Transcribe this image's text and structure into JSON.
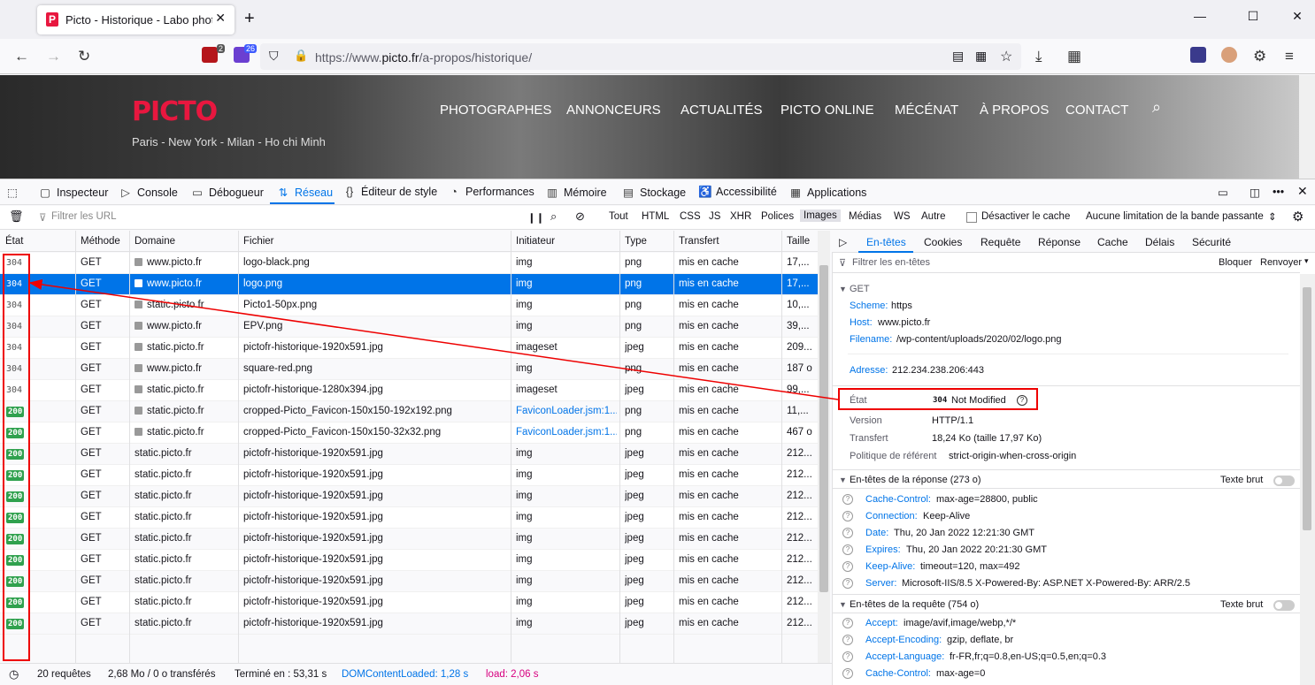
{
  "browser": {
    "tab_title": "Picto - Historique - Labo photo",
    "tab_favicon": "P",
    "url_scheme": "https://www.",
    "url_host": "picto.fr",
    "url_path": "/a-propos/historique/",
    "ext_badge_1": "2",
    "ext_badge_2": "26"
  },
  "site": {
    "logo": "PICTO",
    "tagline": "Paris - New York - Milan - Ho chi Minh",
    "menu": [
      "PHOTOGRAPHES",
      "ANNONCEURS",
      "ACTUALITÉS",
      "PICTO ONLINE",
      "MÉCÉNAT",
      "À PROPOS",
      "CONTACT"
    ]
  },
  "devtools": {
    "tools": [
      "Inspecteur",
      "Console",
      "Débogueur",
      "Réseau",
      "Éditeur de style",
      "Performances",
      "Mémoire",
      "Stockage",
      "Accessibilité",
      "Applications"
    ],
    "filter_placeholder": "Filtrer les URL",
    "types": [
      "Tout",
      "HTML",
      "CSS",
      "JS",
      "XHR",
      "Polices",
      "Images",
      "Médias",
      "WS",
      "Autre"
    ],
    "disable_cache": "Désactiver le cache",
    "throttle": "Aucune limitation de la bande passante",
    "columns": [
      "État",
      "Méthode",
      "Domaine",
      "Fichier",
      "Initiateur",
      "Type",
      "Transfert",
      "Taille"
    ],
    "rows": [
      {
        "status": "304",
        "method": "GET",
        "domain": "www.picto.fr",
        "file": "logo-black.png",
        "initiator": "img",
        "type": "png",
        "transfer": "mis en cache",
        "size": "17,..."
      },
      {
        "status": "304",
        "method": "GET",
        "domain": "www.picto.fr",
        "file": "logo.png",
        "initiator": "img",
        "type": "png",
        "transfer": "mis en cache",
        "size": "17,..."
      },
      {
        "status": "304",
        "method": "GET",
        "domain": "static.picto.fr",
        "file": "Picto1-50px.png",
        "initiator": "img",
        "type": "png",
        "transfer": "mis en cache",
        "size": "10,..."
      },
      {
        "status": "304",
        "method": "GET",
        "domain": "www.picto.fr",
        "file": "EPV.png",
        "initiator": "img",
        "type": "png",
        "transfer": "mis en cache",
        "size": "39,..."
      },
      {
        "status": "304",
        "method": "GET",
        "domain": "static.picto.fr",
        "file": "pictofr-historique-1920x591.jpg",
        "initiator": "imageset",
        "type": "jpeg",
        "transfer": "mis en cache",
        "size": "209..."
      },
      {
        "status": "304",
        "method": "GET",
        "domain": "www.picto.fr",
        "file": "square-red.png",
        "initiator": "img",
        "type": "png",
        "transfer": "mis en cache",
        "size": "187 o"
      },
      {
        "status": "304",
        "method": "GET",
        "domain": "static.picto.fr",
        "file": "pictofr-historique-1280x394.jpg",
        "initiator": "imageset",
        "type": "jpeg",
        "transfer": "mis en cache",
        "size": "99,..."
      },
      {
        "status": "200",
        "method": "GET",
        "domain": "static.picto.fr",
        "file": "cropped-Picto_Favicon-150x150-192x192.png",
        "initiator": "FaviconLoader.jsm:1...",
        "type": "png",
        "transfer": "mis en cache",
        "size": "11,..."
      },
      {
        "status": "200",
        "method": "GET",
        "domain": "static.picto.fr",
        "file": "cropped-Picto_Favicon-150x150-32x32.png",
        "initiator": "FaviconLoader.jsm:1...",
        "type": "png",
        "transfer": "mis en cache",
        "size": "467 o"
      },
      {
        "status": "200",
        "method": "GET",
        "domain": "static.picto.fr",
        "file": "pictofr-historique-1920x591.jpg",
        "initiator": "img",
        "type": "jpeg",
        "transfer": "mis en cache",
        "size": "212..."
      },
      {
        "status": "200",
        "method": "GET",
        "domain": "static.picto.fr",
        "file": "pictofr-historique-1920x591.jpg",
        "initiator": "img",
        "type": "jpeg",
        "transfer": "mis en cache",
        "size": "212..."
      },
      {
        "status": "200",
        "method": "GET",
        "domain": "static.picto.fr",
        "file": "pictofr-historique-1920x591.jpg",
        "initiator": "img",
        "type": "jpeg",
        "transfer": "mis en cache",
        "size": "212..."
      },
      {
        "status": "200",
        "method": "GET",
        "domain": "static.picto.fr",
        "file": "pictofr-historique-1920x591.jpg",
        "initiator": "img",
        "type": "jpeg",
        "transfer": "mis en cache",
        "size": "212..."
      },
      {
        "status": "200",
        "method": "GET",
        "domain": "static.picto.fr",
        "file": "pictofr-historique-1920x591.jpg",
        "initiator": "img",
        "type": "jpeg",
        "transfer": "mis en cache",
        "size": "212..."
      },
      {
        "status": "200",
        "method": "GET",
        "domain": "static.picto.fr",
        "file": "pictofr-historique-1920x591.jpg",
        "initiator": "img",
        "type": "jpeg",
        "transfer": "mis en cache",
        "size": "212..."
      },
      {
        "status": "200",
        "method": "GET",
        "domain": "static.picto.fr",
        "file": "pictofr-historique-1920x591.jpg",
        "initiator": "img",
        "type": "jpeg",
        "transfer": "mis en cache",
        "size": "212..."
      },
      {
        "status": "200",
        "method": "GET",
        "domain": "static.picto.fr",
        "file": "pictofr-historique-1920x591.jpg",
        "initiator": "img",
        "type": "jpeg",
        "transfer": "mis en cache",
        "size": "212..."
      },
      {
        "status": "200",
        "method": "GET",
        "domain": "static.picto.fr",
        "file": "pictofr-historique-1920x591.jpg",
        "initiator": "img",
        "type": "jpeg",
        "transfer": "mis en cache",
        "size": "212..."
      }
    ],
    "status": {
      "requests": "20 requêtes",
      "transferred": "2,68 Mo / 0 o transférés",
      "finished": "Terminé en : 53,31 s",
      "dcl": "DOMContentLoaded: 1,28 s",
      "load": "load: 2,06 s"
    },
    "details": {
      "tabs": [
        "En-têtes",
        "Cookies",
        "Requête",
        "Réponse",
        "Cache",
        "Délais",
        "Sécurité"
      ],
      "filter_placeholder": "Filtrer les en-têtes",
      "block": "Bloquer",
      "resend": "Renvoyer",
      "method": "GET",
      "scheme_k": "Scheme:",
      "scheme_v": "https",
      "host_k": "Host:",
      "host_v": "www.picto.fr",
      "filename_k": "Filename:",
      "filename_v": "/wp-content/uploads/2020/02/logo.png",
      "address_k": "Adresse:",
      "address_v": "212.234.238.206:443",
      "state_k": "État",
      "state_code": "304",
      "state_text": "Not Modified",
      "version_k": "Version",
      "version_v": "HTTP/1.1",
      "transfer_k": "Transfert",
      "transfer_v": "18,24 Ko (taille 17,97 Ko)",
      "referrer_k": "Politique de référent",
      "referrer_v": "strict-origin-when-cross-origin",
      "resp_headers": "En-têtes de la réponse (273 o)",
      "raw": "Texte brut",
      "resp": [
        {
          "k": "Cache-Control:",
          "v": "max-age=28800, public"
        },
        {
          "k": "Connection:",
          "v": "Keep-Alive"
        },
        {
          "k": "Date:",
          "v": "Thu, 20 Jan 2022 12:21:30 GMT"
        },
        {
          "k": "Expires:",
          "v": "Thu, 20 Jan 2022 20:21:30 GMT"
        },
        {
          "k": "Keep-Alive:",
          "v": "timeout=120, max=492"
        },
        {
          "k": "Server:",
          "v": "Microsoft-IIS/8.5 X-Powered-By: ASP.NET X-Powered-By: ARR/2.5"
        }
      ],
      "req_headers": "En-têtes de la requête (754 o)",
      "req": [
        {
          "k": "Accept:",
          "v": "image/avif,image/webp,*/*"
        },
        {
          "k": "Accept-Encoding:",
          "v": "gzip, deflate, br"
        },
        {
          "k": "Accept-Language:",
          "v": "fr-FR,fr;q=0.8,en-US;q=0.5,en;q=0.3"
        },
        {
          "k": "Cache-Control:",
          "v": "max-age=0"
        }
      ]
    }
  }
}
